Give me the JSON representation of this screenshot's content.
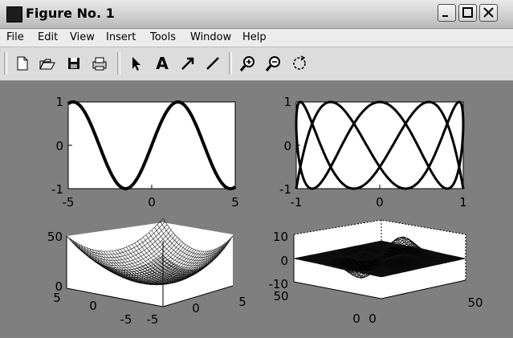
{
  "window": {
    "title": "Figure No. 1"
  },
  "menu": [
    "File",
    "Edit",
    "View",
    "Insert",
    "Tools",
    "Window",
    "Help"
  ],
  "toolbar": {
    "icons": [
      "new-file-icon",
      "open-folder-icon",
      "save-icon",
      "print-icon",
      "select-arrow-icon",
      "text-icon",
      "arrow-icon",
      "line-icon",
      "zoom-in-icon",
      "zoom-out-icon",
      "rotate-icon"
    ],
    "text_tool_label": "A"
  },
  "colors": {
    "figure_background": "#7f7f7f",
    "axes_background": "#ffffff",
    "line": "#000000"
  },
  "chart_data": [
    {
      "type": "line",
      "x": [
        -5,
        -4,
        -3,
        -2,
        -1,
        0,
        1,
        2,
        3,
        4,
        5
      ],
      "y": [
        0.959,
        0.757,
        -0.141,
        -0.909,
        -0.841,
        0,
        0.841,
        0.909,
        0.141,
        -0.757,
        -0.959
      ],
      "xlim": [
        -5,
        5
      ],
      "ylim": [
        -1,
        1
      ],
      "xticks": [
        "-5",
        "0",
        "5"
      ],
      "yticks": [
        "-1",
        "0",
        "1"
      ]
    },
    {
      "type": "line",
      "description_values": "Lissajous-like curve",
      "xlim": [
        -1,
        1
      ],
      "ylim": [
        -1,
        1
      ],
      "xticks": [
        "-1",
        "0",
        "1"
      ],
      "yticks": [
        "-1",
        "0",
        "1"
      ]
    },
    {
      "type": "surface",
      "zlim": [
        0,
        50
      ],
      "x_ticks": [
        "5",
        "0",
        "-5"
      ],
      "y_ticks": [
        "-5",
        "0",
        "5"
      ],
      "z_ticks": [
        "0",
        "50"
      ]
    },
    {
      "type": "surface",
      "zlim": [
        -10,
        10
      ],
      "x_ticks": [
        "50",
        "0"
      ],
      "y_ticks": [
        "0",
        "50"
      ],
      "z_ticks": [
        "-10",
        "0",
        "10"
      ]
    }
  ]
}
